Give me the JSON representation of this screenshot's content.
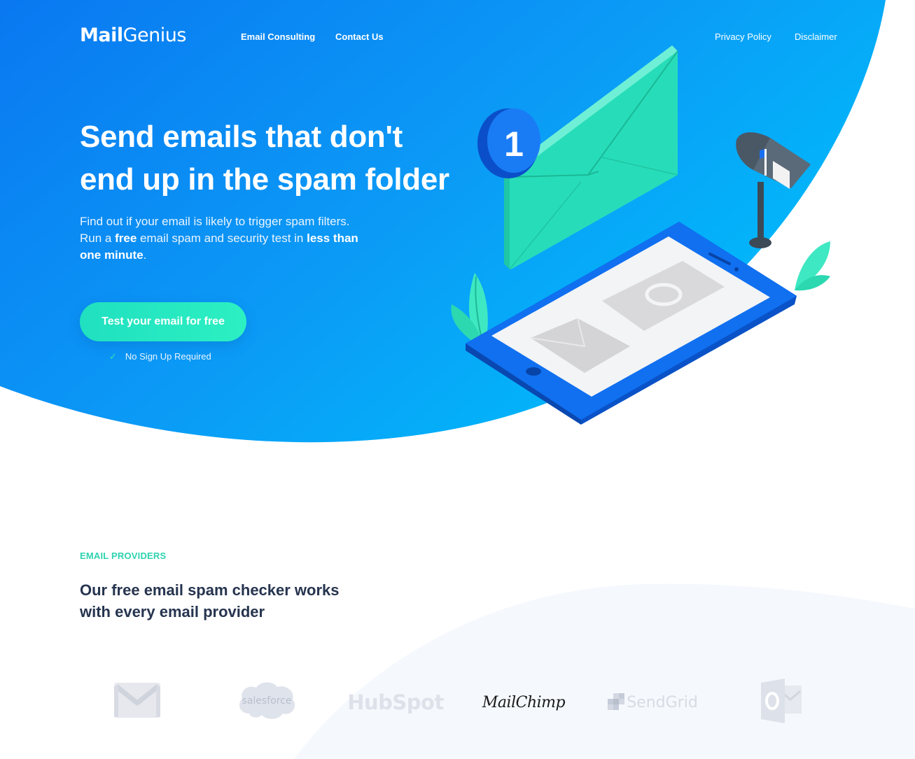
{
  "brand": {
    "logo_bold": "Mail",
    "logo_light": "Genius"
  },
  "nav": {
    "left": [
      "Email Consulting",
      "Contact Us"
    ],
    "right": [
      "Privacy Policy",
      "Disclaimer"
    ]
  },
  "hero": {
    "title_line1": "Send emails that don't",
    "title_line2": "end up in the spam folder",
    "sub_part1": "Find out if your email is likely to trigger spam filters. Run a ",
    "sub_free": "free",
    "sub_part2": " email spam and security test in ",
    "sub_minute": "less than one minute",
    "sub_end": ".",
    "cta_label": "Test your email for free",
    "no_signup": "No Sign Up Required",
    "notification_count": "1"
  },
  "providers": {
    "eyebrow": "EMAIL PROVIDERS",
    "title": "Our free email spam checker works with every email provider",
    "logos": [
      "gmail-icon",
      "salesforce",
      "HubSpot",
      "MailChimp",
      "SendGrid",
      "outlook-icon"
    ],
    "salesforce_text": "salesforce",
    "hubspot_text": "HubSpot",
    "mailchimp_text": "MailChimp",
    "sendgrid_text": "SendGrid"
  },
  "colors": {
    "hero_gradient_start": "#0a7cf2",
    "hero_gradient_end": "#00b9fb",
    "accent_teal": "#2ed3b0",
    "heading_dark": "#26344f"
  }
}
